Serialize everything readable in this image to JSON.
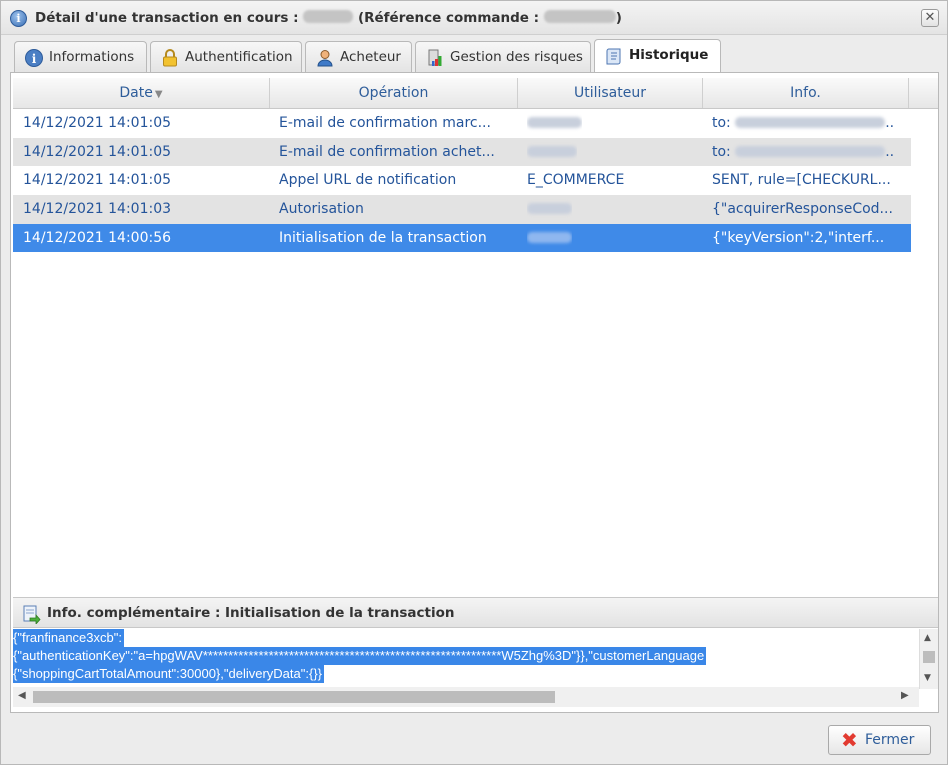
{
  "dialog": {
    "title_prefix": "Détail d'une transaction en cours :",
    "title_middle": "(Référence commande :",
    "title_suffix": ")",
    "close_glyph": "✕"
  },
  "tabs": [
    {
      "label": "Informations",
      "icon": "info-icon",
      "active": false
    },
    {
      "label": "Authentification",
      "icon": "lock-icon",
      "active": false
    },
    {
      "label": "Acheteur",
      "icon": "user-icon",
      "active": false
    },
    {
      "label": "Gestion des risques",
      "icon": "risk-icon",
      "active": false
    },
    {
      "label": "Historique",
      "icon": "history-icon",
      "active": true
    }
  ],
  "grid": {
    "columns": [
      "Date",
      "Opération",
      "Utilisateur",
      "Info."
    ],
    "sort_indicator": "▼",
    "rows": [
      {
        "date": "14/12/2021 14:01:05",
        "operation": "E-mail de confirmation marc...",
        "user": "",
        "info_prefix": "to: ",
        "info": "",
        "info_suffix": ".."
      },
      {
        "date": "14/12/2021 14:01:05",
        "operation": "E-mail de confirmation achet...",
        "user": "",
        "info_prefix": "to: ",
        "info": "",
        "info_suffix": ".."
      },
      {
        "date": "14/12/2021 14:01:05",
        "operation": "Appel URL de notification",
        "user": "E_COMMERCE",
        "info_prefix": "",
        "info": "SENT, rule=[CHECKURL...",
        "info_suffix": ""
      },
      {
        "date": "14/12/2021 14:01:03",
        "operation": "Autorisation",
        "user": "",
        "info_prefix": "",
        "info": "{\"acquirerResponseCod...",
        "info_suffix": ""
      },
      {
        "date": "14/12/2021 14:00:56",
        "operation": "Initialisation de la transaction",
        "user": "",
        "info_prefix": "",
        "info": "{\"keyVersion\":2,\"interf...",
        "info_suffix": ""
      }
    ]
  },
  "info_panel": {
    "title": "Info. complémentaire : Initialisation de la transaction",
    "lines": [
      "{\"franfinance3xcb\":",
      "{\"authenticationKey\":\"a=hpgWAV***********************************************************W5Zhg%3D\"}},\"customerLanguage",
      "{\"shoppingCartTotalAmount\":30000},\"deliveryData\":{}}"
    ]
  },
  "footer": {
    "close_label": "Fermer"
  },
  "colors": {
    "accent": "#3f8ae8",
    "link_text": "#24549a",
    "close_red": "#e23a30"
  }
}
